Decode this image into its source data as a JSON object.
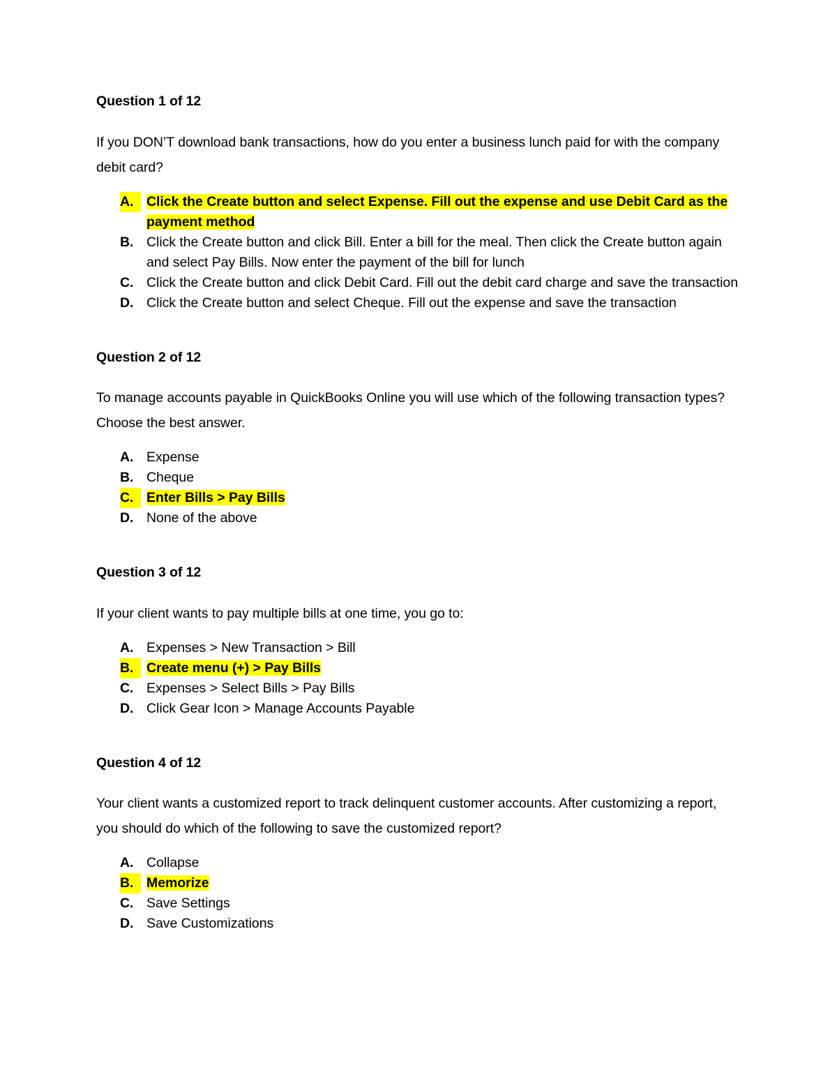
{
  "document": {
    "title": "Question 1 of 12",
    "highlight_color": "#ffff00",
    "text_color": "#000000",
    "background_color": "#ffffff"
  },
  "questions": [
    {
      "heading": "Question 1 of 12",
      "stem": "If you DON’T download bank transactions, how do you enter a business lunch paid for with the company debit card?",
      "options": [
        {
          "marker": "A.",
          "text": "Click the Create button and select Expense. Fill out the expense and use Debit Card as the payment method",
          "highlighted": true
        },
        {
          "marker": "B.",
          "text": "Click the Create button and click Bill. Enter a bill for the meal. Then click the Create button again and select Pay Bills. Now enter the payment of the bill for lunch",
          "highlighted": false
        },
        {
          "marker": "C.",
          "text": "Click the Create button and click Debit Card. Fill out the debit card charge and save the transaction",
          "highlighted": false
        },
        {
          "marker": "D.",
          "text": "Click the Create button and select Cheque. Fill out the expense and save the transaction",
          "highlighted": false
        }
      ]
    },
    {
      "heading": "Question 2 of 12",
      "stem": "To manage accounts payable in QuickBooks Online you will use which of the following transaction types? Choose the best answer.",
      "options": [
        {
          "marker": "A.",
          "text": "Expense",
          "highlighted": false
        },
        {
          "marker": "B.",
          "text": "Cheque",
          "highlighted": false
        },
        {
          "marker": "C.",
          "text": "Enter Bills > Pay Bills",
          "highlighted": true
        },
        {
          "marker": "D.",
          "text": "None of the above",
          "highlighted": false
        }
      ]
    },
    {
      "heading": "Question 3 of 12",
      "stem": "If your client wants to pay multiple bills at one time, you go to:",
      "options": [
        {
          "marker": "A.",
          "text": "Expenses > New Transaction > Bill",
          "highlighted": false
        },
        {
          "marker": "B.",
          "text": "Create menu (+) > Pay Bills",
          "highlighted": true
        },
        {
          "marker": "C.",
          "text": "Expenses > Select Bills > Pay Bills",
          "highlighted": false
        },
        {
          "marker": "D.",
          "text": "Click Gear Icon > Manage Accounts Payable",
          "highlighted": false
        }
      ]
    },
    {
      "heading": "Question 4 of 12",
      "stem": "Your client wants a customized report to track delinquent customer accounts. After customizing a report, you should do which of the following to save the customized report?",
      "options": [
        {
          "marker": "A.",
          "text": "Collapse",
          "highlighted": false
        },
        {
          "marker": "B.",
          "text": "Memorize",
          "highlighted": true
        },
        {
          "marker": "C.",
          "text": "Save Settings",
          "highlighted": false
        },
        {
          "marker": "D.",
          "text": "Save Customizations",
          "highlighted": false
        }
      ]
    }
  ]
}
